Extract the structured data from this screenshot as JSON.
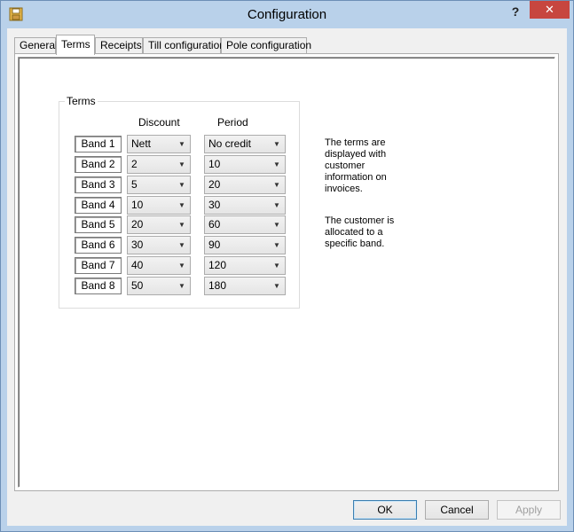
{
  "window": {
    "title": "Configuration",
    "help_label": "?",
    "close_label": "✕"
  },
  "tabs": [
    {
      "label": "General"
    },
    {
      "label": "Terms"
    },
    {
      "label": "Receipts"
    },
    {
      "label": "Till configuration"
    },
    {
      "label": "Pole configuration"
    }
  ],
  "active_tab": "Terms",
  "terms": {
    "group_label": "Terms",
    "discount_header": "Discount",
    "period_header": "Period",
    "bands": [
      {
        "label": "Band 1",
        "discount": "Nett",
        "period": "No credit"
      },
      {
        "label": "Band 2",
        "discount": "2",
        "period": "10"
      },
      {
        "label": "Band 3",
        "discount": "5",
        "period": "20"
      },
      {
        "label": "Band 4",
        "discount": "10",
        "period": "30"
      },
      {
        "label": "Band 5",
        "discount": "20",
        "period": "60"
      },
      {
        "label": "Band 6",
        "discount": "30",
        "period": "90"
      },
      {
        "label": "Band 7",
        "discount": "40",
        "period": "120"
      },
      {
        "label": "Band 8",
        "discount": "50",
        "period": "180"
      }
    ],
    "info_1": "The terms are displayed with customer information on invoices.",
    "info_2": "The customer is allocated to a specific band."
  },
  "buttons": {
    "ok": "OK",
    "cancel": "Cancel",
    "apply": "Apply"
  },
  "icons": {
    "app": "floppy-disk-icon",
    "dropdown": "chevron-down-icon"
  }
}
